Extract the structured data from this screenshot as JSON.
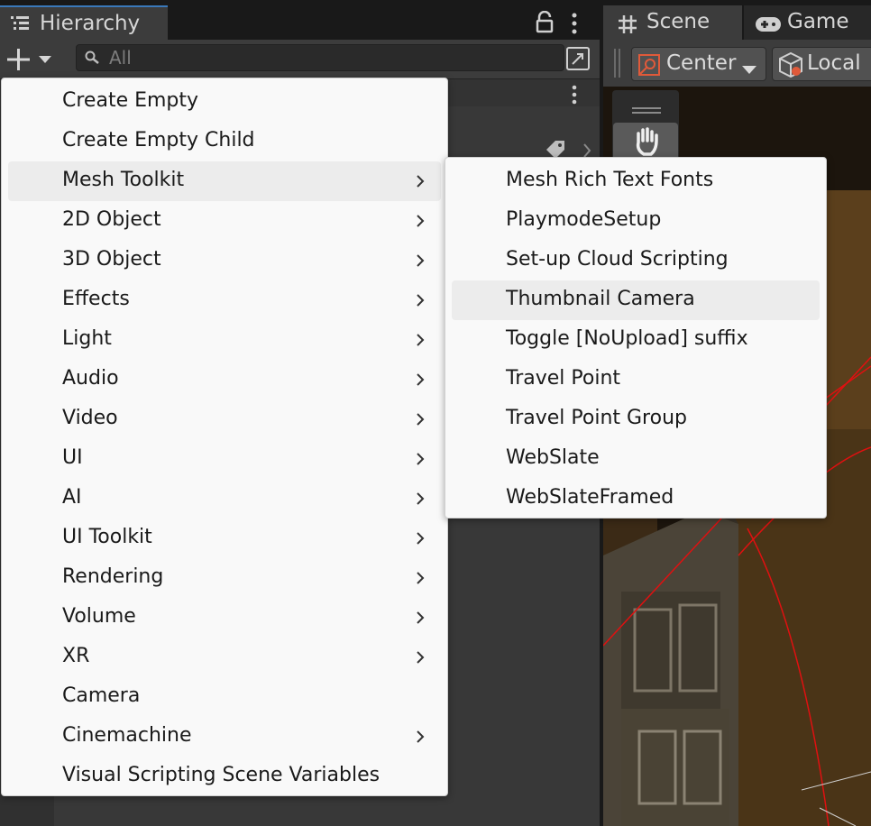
{
  "hierarchy": {
    "tab_label": "Hierarchy",
    "search": {
      "placeholder": "All",
      "value": ""
    }
  },
  "scene": {
    "tabs": [
      {
        "label": "Scene"
      },
      {
        "label": "Game"
      }
    ],
    "pivot_mode": "Center",
    "pivot_rotation": "Local"
  },
  "create_menu": {
    "items": [
      {
        "label": "Create Empty",
        "submenu": false
      },
      {
        "label": "Create Empty Child",
        "submenu": false
      },
      {
        "label": "Mesh Toolkit",
        "submenu": true,
        "highlighted": true
      },
      {
        "label": "2D Object",
        "submenu": true
      },
      {
        "label": "3D Object",
        "submenu": true
      },
      {
        "label": "Effects",
        "submenu": true
      },
      {
        "label": "Light",
        "submenu": true
      },
      {
        "label": "Audio",
        "submenu": true
      },
      {
        "label": "Video",
        "submenu": true
      },
      {
        "label": "UI",
        "submenu": true
      },
      {
        "label": "AI",
        "submenu": true
      },
      {
        "label": "UI Toolkit",
        "submenu": true
      },
      {
        "label": "Rendering",
        "submenu": true
      },
      {
        "label": "Volume",
        "submenu": true
      },
      {
        "label": "XR",
        "submenu": true
      },
      {
        "label": "Camera",
        "submenu": false
      },
      {
        "label": "Cinemachine",
        "submenu": true
      },
      {
        "label": "Visual Scripting Scene Variables",
        "submenu": false
      }
    ]
  },
  "mesh_toolkit_submenu": {
    "items": [
      {
        "label": "Mesh Rich Text Fonts"
      },
      {
        "label": "PlaymodeSetup"
      },
      {
        "label": "Set-up Cloud Scripting"
      },
      {
        "label": "Thumbnail Camera",
        "highlighted": true
      },
      {
        "label": "Toggle [NoUpload] suffix"
      },
      {
        "label": "Travel Point"
      },
      {
        "label": "Travel Point Group"
      },
      {
        "label": "WebSlate"
      },
      {
        "label": "WebSlateFramed"
      }
    ]
  },
  "colors": {
    "menu_bg": "#f9f9f9",
    "menu_highlight": "#ececec",
    "tab_accent": "#3a79bb",
    "editor_dark": "#383838"
  }
}
